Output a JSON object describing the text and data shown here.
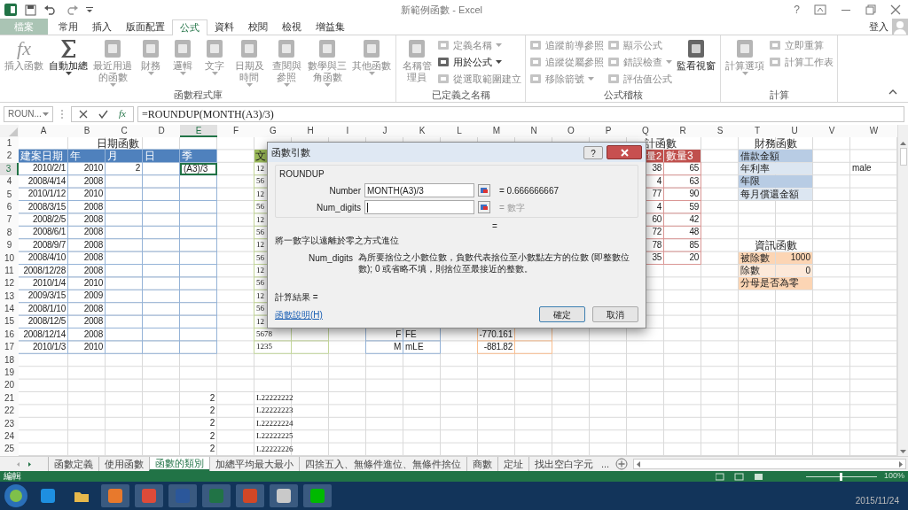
{
  "window": {
    "title": "新範例函數 - Excel",
    "help": "?",
    "sign_in": "登入"
  },
  "ribbon_tabs": [
    {
      "label": "檔案",
      "kind": "file",
      "selected": false
    },
    {
      "label": "常用",
      "kind": "tab",
      "selected": false
    },
    {
      "label": "插入",
      "kind": "tab",
      "selected": false
    },
    {
      "label": "版面配置",
      "kind": "tab",
      "selected": false
    },
    {
      "label": "公式",
      "kind": "tab",
      "selected": true
    },
    {
      "label": "資料",
      "kind": "tab",
      "selected": false
    },
    {
      "label": "校閱",
      "kind": "tab",
      "selected": false
    },
    {
      "label": "檢視",
      "kind": "tab",
      "selected": false
    },
    {
      "label": "增益集",
      "kind": "tab",
      "selected": false
    }
  ],
  "ribbon_groups": [
    {
      "label": "函數程式庫",
      "items": [
        {
          "label": "插入函數",
          "kind": "large",
          "icon_text": "fx",
          "disabled": true,
          "dropdown": false
        },
        {
          "label": "自動加總",
          "kind": "large",
          "disabled": false,
          "dropdown": true
        },
        {
          "label": "最近用過的函數",
          "kind": "large",
          "disabled": true,
          "dropdown": true
        },
        {
          "label": "財務",
          "kind": "large",
          "disabled": true,
          "dropdown": true
        },
        {
          "label": "邏輯",
          "kind": "large",
          "disabled": true,
          "dropdown": true
        },
        {
          "label": "文字",
          "kind": "large",
          "disabled": true,
          "dropdown": true
        },
        {
          "label": "日期及時間",
          "kind": "large",
          "disabled": true,
          "dropdown": true
        },
        {
          "label": "查閱與參照",
          "kind": "large",
          "disabled": true,
          "dropdown": true
        },
        {
          "label": "數學與三角函數",
          "kind": "large",
          "disabled": true,
          "dropdown": true
        },
        {
          "label": "其他函數",
          "kind": "large",
          "disabled": true,
          "dropdown": true
        }
      ]
    },
    {
      "label": "已定義之名稱",
      "items": [
        {
          "label": "名稱管理員",
          "kind": "large",
          "disabled": true,
          "dropdown": false
        },
        {
          "label": "定義名稱",
          "kind": "small",
          "disabled": true,
          "dropdown": true
        },
        {
          "label": "用於公式",
          "kind": "small",
          "disabled": false,
          "dropdown": true
        },
        {
          "label": "從選取範圍建立",
          "kind": "small",
          "disabled": true,
          "dropdown": false
        }
      ]
    },
    {
      "label": "公式稽核",
      "items": [
        {
          "label": "追蹤前導參照",
          "kind": "small",
          "disabled": true,
          "dropdown": false
        },
        {
          "label": "追蹤從屬參照",
          "kind": "small",
          "disabled": true,
          "dropdown": false
        },
        {
          "label": "移除箭號",
          "kind": "small",
          "disabled": true,
          "dropdown": true
        },
        {
          "label": "顯示公式",
          "kind": "small",
          "disabled": true,
          "dropdown": false
        },
        {
          "label": "錯誤檢查",
          "kind": "small",
          "disabled": true,
          "dropdown": true
        },
        {
          "label": "評估值公式",
          "kind": "small",
          "disabled": true,
          "dropdown": false
        },
        {
          "label": "監看視窗",
          "kind": "large",
          "disabled": false,
          "dropdown": false
        }
      ]
    },
    {
      "label": "計算",
      "items": [
        {
          "label": "計算選項",
          "kind": "large",
          "disabled": true,
          "dropdown": true
        },
        {
          "label": "立即重算",
          "kind": "small",
          "disabled": true,
          "dropdown": false
        },
        {
          "label": "計算工作表",
          "kind": "small",
          "disabled": true,
          "dropdown": false
        }
      ]
    }
  ],
  "formula_bar": {
    "name_box": "ROUN...",
    "function_button": "fx",
    "formula": "=ROUNDUP(MONTH(A3)/3)"
  },
  "sheet": {
    "columns": [
      {
        "label": "A",
        "selected": false
      },
      {
        "label": "B",
        "selected": false
      },
      {
        "label": "C",
        "selected": false
      },
      {
        "label": "D",
        "selected": false
      },
      {
        "label": "E",
        "selected": true
      },
      {
        "label": "F",
        "selected": false
      },
      {
        "label": "G",
        "selected": false
      },
      {
        "label": "H",
        "selected": false
      },
      {
        "label": "I",
        "selected": false
      },
      {
        "label": "J",
        "selected": false
      },
      {
        "label": "K",
        "selected": false
      },
      {
        "label": "L",
        "selected": false
      },
      {
        "label": "M",
        "selected": false
      },
      {
        "label": "N",
        "selected": false
      },
      {
        "label": "O",
        "selected": false
      },
      {
        "label": "P",
        "selected": false
      },
      {
        "label": "Q",
        "selected": false
      },
      {
        "label": "R",
        "selected": false
      },
      {
        "label": "S",
        "selected": false
      },
      {
        "label": "T",
        "selected": false
      },
      {
        "label": "U",
        "selected": false
      },
      {
        "label": "V",
        "selected": false
      },
      {
        "label": "W",
        "selected": false
      }
    ],
    "row_numbers": [
      {
        "label": "1",
        "selected": false
      },
      {
        "label": "2",
        "selected": false
      },
      {
        "label": "3",
        "selected": true
      },
      {
        "label": "4",
        "selected": false
      },
      {
        "label": "5",
        "selected": false
      },
      {
        "label": "6",
        "selected": false
      },
      {
        "label": "7",
        "selected": false
      },
      {
        "label": "8",
        "selected": false
      },
      {
        "label": "9",
        "selected": false
      },
      {
        "label": "10",
        "selected": false
      },
      {
        "label": "11",
        "selected": false
      },
      {
        "label": "12",
        "selected": false
      },
      {
        "label": "13",
        "selected": false
      },
      {
        "label": "14",
        "selected": false
      },
      {
        "label": "15",
        "selected": false
      },
      {
        "label": "16",
        "selected": false
      },
      {
        "label": "17",
        "selected": false
      },
      {
        "label": "18",
        "selected": false
      },
      {
        "label": "19",
        "selected": false
      },
      {
        "label": "20",
        "selected": false
      },
      {
        "label": "21",
        "selected": false
      },
      {
        "label": "22",
        "selected": false
      },
      {
        "label": "23",
        "selected": false
      },
      {
        "label": "24",
        "selected": false
      },
      {
        "label": "25",
        "selected": false
      }
    ],
    "date_table": {
      "title": "日期函數",
      "headers": [
        "建案日期",
        "年",
        "月",
        "日",
        "季"
      ],
      "rows": [
        {
          "date": "2010/2/1",
          "year": "2010",
          "month": "2",
          "quarter": "(A3)/3",
          "selected": true
        },
        {
          "date": "2008/4/14",
          "year": "2008",
          "selected": false
        },
        {
          "date": "2010/1/12",
          "year": "2010",
          "selected": false
        },
        {
          "date": "2008/3/15",
          "year": "2008",
          "selected": false
        },
        {
          "date": "2008/2/5",
          "year": "2008",
          "selected": false
        },
        {
          "date": "2008/6/1",
          "year": "2008",
          "selected": false
        },
        {
          "date": "2008/9/7",
          "year": "2008",
          "selected": false
        },
        {
          "date": "2008/4/10",
          "year": "2008",
          "selected": false
        },
        {
          "date": "2008/12/28",
          "year": "2008",
          "selected": false
        },
        {
          "date": "2010/1/4",
          "year": "2010",
          "selected": false
        },
        {
          "date": "2009/3/15",
          "year": "2009",
          "selected": false
        },
        {
          "date": "2008/1/10",
          "year": "2008",
          "selected": false
        },
        {
          "date": "2008/12/5",
          "year": "2008",
          "selected": false
        },
        {
          "date": "2008/12/14",
          "year": "2008",
          "selected": false
        },
        {
          "date": "2010/1/3",
          "year": "2010",
          "selected": false
        }
      ]
    },
    "text_table": {
      "header": "文",
      "values": [
        "12",
        "56",
        "12",
        "56",
        "12",
        "56",
        "12",
        "56",
        "12",
        "56",
        "12",
        "56",
        "12",
        "5678",
        "1235"
      ]
    },
    "logic_table": {
      "rows": [
        {
          "code": "F",
          "result": "FE"
        },
        {
          "code": "M",
          "result": "mLE"
        }
      ]
    },
    "math_table": {
      "values": [
        "-770.161",
        "-881.82"
      ]
    },
    "statistics_table": {
      "title": "計函數",
      "headers": [
        "量2",
        "數量3"
      ],
      "rows": [
        [
          "38",
          "65"
        ],
        [
          "4",
          "63"
        ],
        [
          "77",
          "90"
        ],
        [
          "4",
          "59"
        ],
        [
          "60",
          "42"
        ],
        [
          "72",
          "48"
        ],
        [
          "78",
          "85"
        ],
        [
          "35",
          "20"
        ]
      ]
    },
    "finance_table": {
      "title": "財務函數",
      "fields": [
        {
          "label": "借款金額",
          "kind": "dark"
        },
        {
          "label": "年利率",
          "kind": "light"
        },
        {
          "label": "年限",
          "kind": "dark"
        },
        {
          "label": "每月償還金額",
          "kind": "light"
        }
      ]
    },
    "side_note": "male",
    "information_table": {
      "title": "資訊函數",
      "fields": [
        {
          "label": "被除數",
          "value": "1000",
          "kind": "dark"
        },
        {
          "label": "除數",
          "value": "0",
          "kind": "light"
        },
        {
          "label": "分母是否為零",
          "kind": "dark"
        }
      ]
    },
    "lower_rows": [
      {
        "number": "2",
        "code": "L22222222"
      },
      {
        "number": "2",
        "code": "L22222223"
      },
      {
        "number": "2",
        "code": "L22222224"
      },
      {
        "number": "2",
        "code": "L22222225"
      },
      {
        "number": "2",
        "code": "L22222226"
      }
    ]
  },
  "dialog": {
    "title": "函數引數",
    "help": "?",
    "function_name": "ROUNDUP",
    "arguments": [
      {
        "label": "Number",
        "value": "MONTH(A3)/3",
        "result": "= 0.666666667",
        "result_muted": false
      },
      {
        "label": "Num_digits",
        "result": "= 數字",
        "result_muted": true
      }
    ],
    "result_line": "=",
    "description": "將一數字以遠離於零之方式進位",
    "argument_help_label": "Num_digits",
    "argument_help": "為所要捨位之小數位數，負數代表捨位至小數點左方的位數 (即整數位數); 0 或省略不填，則捨位至最接近的整數。",
    "calculation_result": "計算結果 =",
    "help_link": "函數說明(H)",
    "ok": "確定",
    "cancel": "取消"
  },
  "sheet_tabs": [
    {
      "label": "函數定義",
      "selected": false
    },
    {
      "label": "使用函數",
      "selected": false
    },
    {
      "label": "函數的類別",
      "selected": true
    },
    {
      "label": "加總平均最大最小",
      "selected": false
    },
    {
      "label": "四捨五入、無條件進位、無條件捨位",
      "selected": false
    },
    {
      "label": "商數",
      "selected": false
    },
    {
      "label": "定址",
      "selected": false
    },
    {
      "label": "找出空白字元",
      "selected": false
    }
  ],
  "more_tabs": "...",
  "status_bar": {
    "mode": "編輯",
    "zoom": "100%",
    "zoom_slider": {
      "level": 0.5
    }
  },
  "taskbar": {
    "date": "2015/11/24"
  }
}
